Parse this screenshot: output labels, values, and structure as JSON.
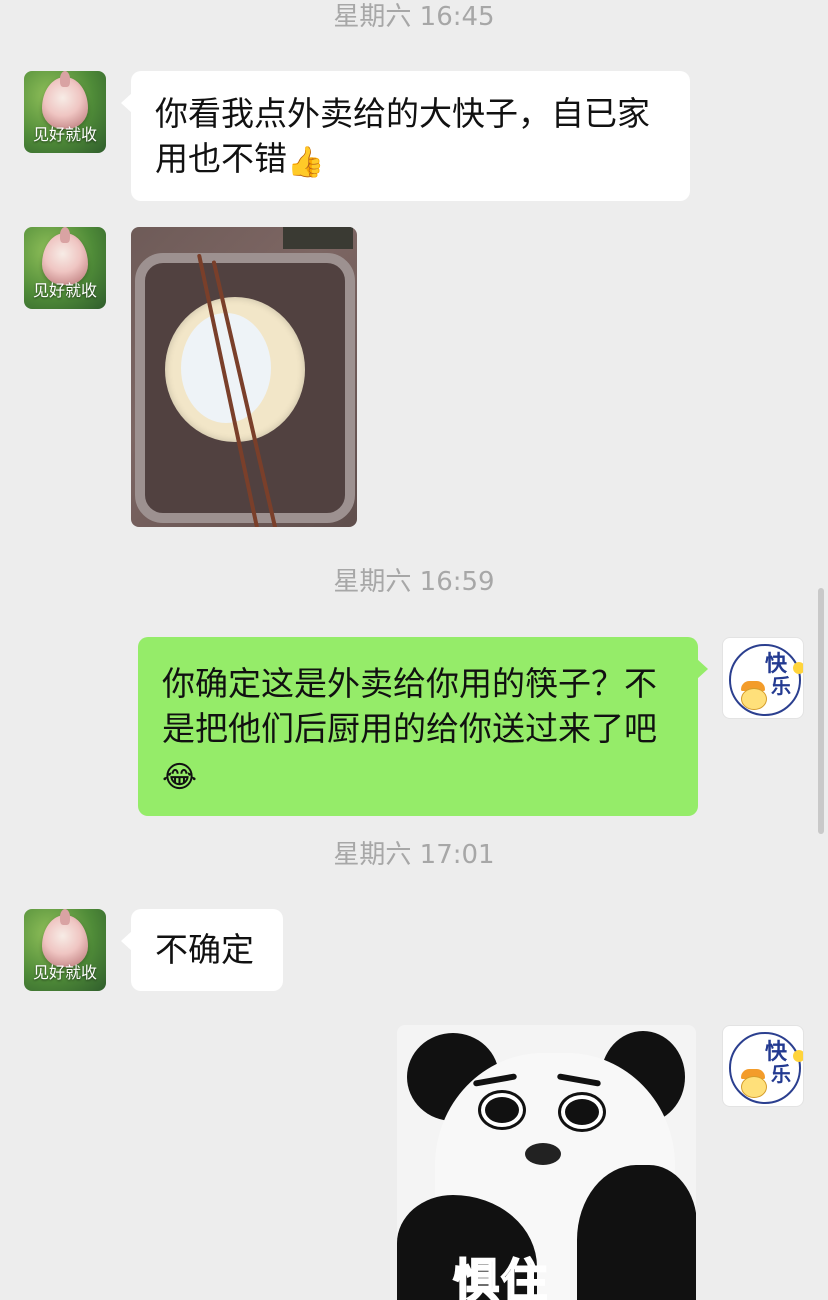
{
  "colors": {
    "background": "#ededed",
    "incoming_bubble": "#ffffff",
    "outgoing_bubble": "#95ec69",
    "timestamp_text": "#a7a7a7"
  },
  "contact": {
    "avatar_caption": "见好就收",
    "avatar_icon": "lotus-bud-avatar"
  },
  "me": {
    "avatar_icon": "duck-avatar",
    "avatar_text_1": "快",
    "avatar_text_2": "乐"
  },
  "timestamps": {
    "t1": "星期六 16:45",
    "t2": "星期六 16:59",
    "t3": "星期六 17:01"
  },
  "messages": {
    "m1": {
      "text": "你看我点外卖给的大快子，自已家用也不错",
      "emoji": "👍"
    },
    "m2": {
      "type": "image",
      "description_icon": "chopsticks-photo"
    },
    "m3": {
      "text": "你确定这是外卖给你用的筷子？不是把他们后厨用的给你送过来了吧",
      "emoji": "😂"
    },
    "m4": {
      "text": "不确定"
    },
    "m5": {
      "type": "sticker",
      "sticker_text": "惧住"
    }
  }
}
